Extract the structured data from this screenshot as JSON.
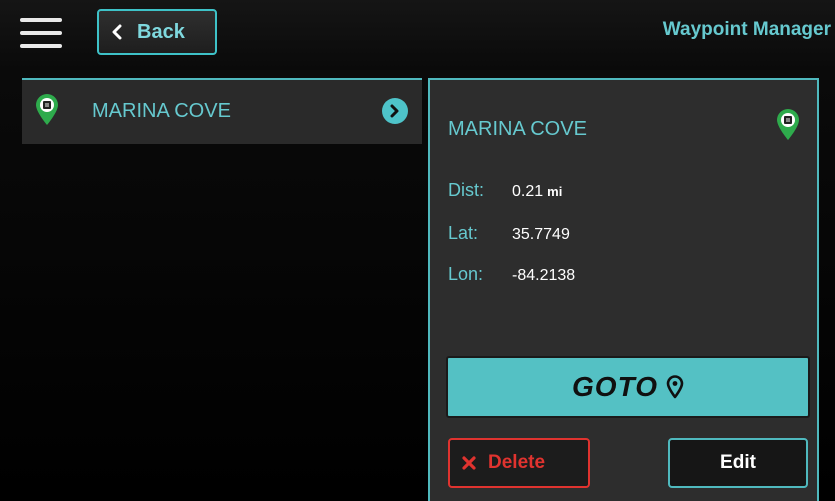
{
  "header": {
    "title": "Waypoint Manager",
    "back_label": "Back",
    "menu_icon": "hamburger-menu-icon"
  },
  "waypoint_list": [
    {
      "name": "MARINA COVE",
      "icon": "waypoint-pin-icon",
      "action_icon": "chevron-right-icon"
    }
  ],
  "details": {
    "name": "MARINA COVE",
    "dist_label": "Dist:",
    "dist_value": "0.21",
    "dist_unit": "mi",
    "lat_label": "Lat:",
    "lat_value": "35.7749",
    "lon_label": "Lon:",
    "lon_value": "-84.2138"
  },
  "actions": {
    "goto_label": "GOTO",
    "delete_label": "Delete",
    "edit_label": "Edit"
  },
  "colors": {
    "accent": "#4fb9be",
    "accent_text": "#66c9cf",
    "goto_bg": "#54c1c4",
    "danger": "#e0332f",
    "pin_green": "#2eab4c"
  }
}
